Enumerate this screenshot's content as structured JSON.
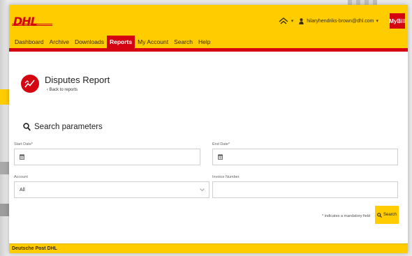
{
  "brand": {
    "logo_text": "DHL",
    "footer_text": "Deutsche Post DHL"
  },
  "header": {
    "user_email": "hilaryhendriks-brown@dhl.com",
    "mybill_label": "MyBill"
  },
  "nav": {
    "items": [
      {
        "label": "Dashboard",
        "active": false
      },
      {
        "label": "Archive",
        "active": false
      },
      {
        "label": "Downloads",
        "active": false
      },
      {
        "label": "Reports",
        "active": true
      },
      {
        "label": "My Account",
        "active": false
      },
      {
        "label": "Search",
        "active": false
      },
      {
        "label": "Help",
        "active": false
      }
    ]
  },
  "page": {
    "title": "Disputes Report",
    "back_link": "Back to reports"
  },
  "search": {
    "heading": "Search parameters",
    "start_date_label": "Start Date*",
    "end_date_label": "End Date*",
    "account_label": "Account",
    "account_value": "All",
    "invoice_label": "Invoice Number",
    "invoice_value": "",
    "mandatory_note": "* indicates a mandatory field",
    "button_label": "Search"
  },
  "colors": {
    "brand_yellow": "#ffcc00",
    "brand_red": "#d40511"
  }
}
